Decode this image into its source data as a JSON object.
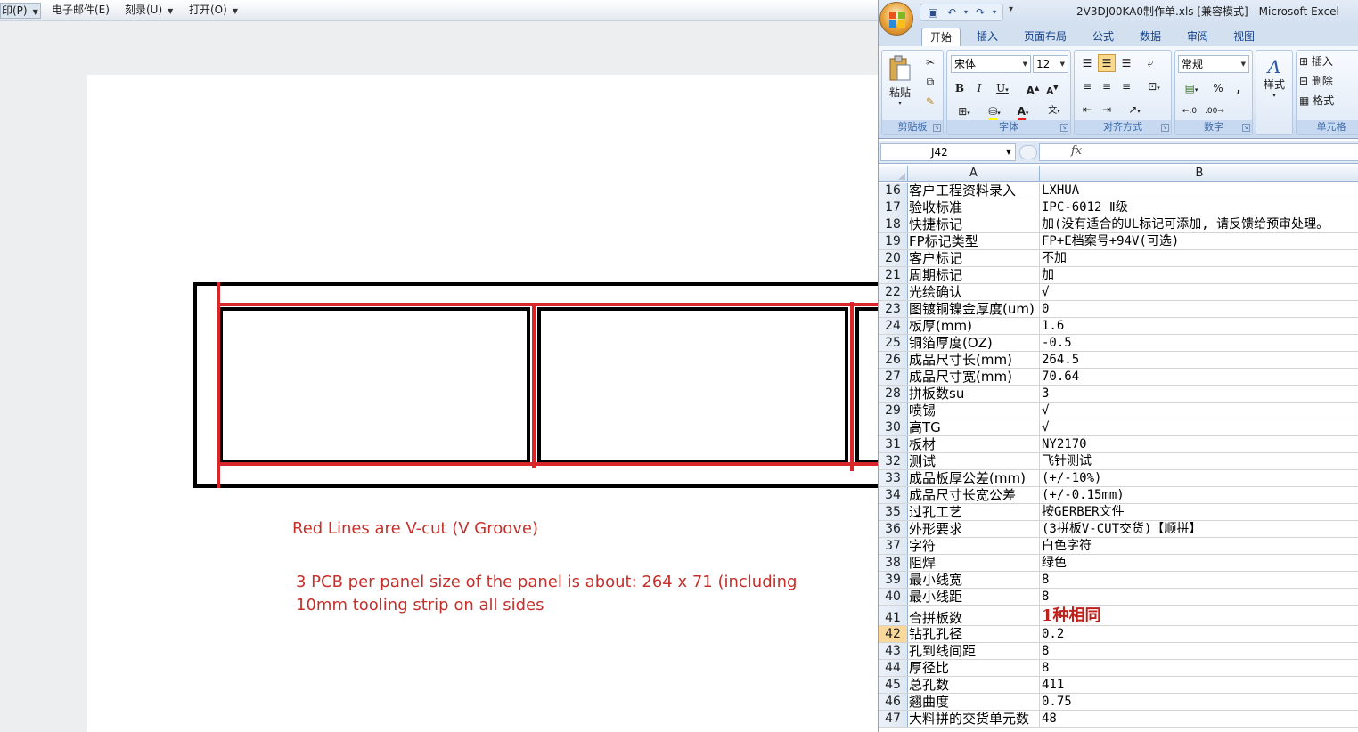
{
  "explorer_bar": {
    "print_label": "印(P)",
    "email_label": "电子邮件(E)",
    "burn_label": "刻录(U)",
    "open_label": "打开(O)"
  },
  "document": {
    "vcut_note": "Red Lines are V-cut (V Groove)",
    "panel_note_line1": "3 PCB per panel  size of the panel is about:  264 x 71  (including",
    "panel_note_line2": "10mm tooling strip on all sides",
    "colors": {
      "board_outline": "#000000",
      "vcut": "#d9262b",
      "text": "#c4302b"
    }
  },
  "excel": {
    "window_title": "2V3DJ00KA0制作单.xls  [兼容模式] - Microsoft Excel",
    "tabs": [
      "开始",
      "插入",
      "页面布局",
      "公式",
      "数据",
      "审阅",
      "视图"
    ],
    "active_tab": "开始",
    "ribbon": {
      "clipboard": {
        "paste_label": "粘贴",
        "group_label": "剪贴板"
      },
      "font": {
        "font_name": "宋体",
        "font_size": "12",
        "group_label": "字体"
      },
      "alignment": {
        "group_label": "对齐方式"
      },
      "number": {
        "format": "常规",
        "group_label": "数字"
      },
      "styles": {
        "label": "样式"
      },
      "cells": {
        "insert_label": "插入",
        "delete_label": "删除",
        "format_label": "格式",
        "group_label": "单元格"
      }
    },
    "name_box": "J42",
    "fx_label": "fx",
    "columns": [
      "A",
      "B"
    ],
    "selected_row": "42",
    "rows": [
      {
        "num": "16",
        "a": "客户工程资料录入",
        "b": "LXHUA"
      },
      {
        "num": "17",
        "a": "验收标准",
        "b": "IPC-6012 Ⅱ级"
      },
      {
        "num": "18",
        "a": "快捷标记",
        "b": "加(没有适合的UL标记可添加, 请反馈给预审处理。"
      },
      {
        "num": "19",
        "a": "FP标记类型",
        "b": "FP+E档案号+94V(可选)"
      },
      {
        "num": "20",
        "a": "客户标记",
        "b": "不加"
      },
      {
        "num": "21",
        "a": "周期标记",
        "b": "加"
      },
      {
        "num": "22",
        "a": "光绘确认",
        "b": "√"
      },
      {
        "num": "23",
        "a": "图镀铜镍金厚度(um)",
        "b": "0"
      },
      {
        "num": "24",
        "a": "板厚(mm)",
        "b": "1.6"
      },
      {
        "num": "25",
        "a": "铜箔厚度(OZ)",
        "b": "-0.5"
      },
      {
        "num": "26",
        "a": "成品尺寸长(mm)",
        "b": "264.5"
      },
      {
        "num": "27",
        "a": "成品尺寸宽(mm)",
        "b": "70.64"
      },
      {
        "num": "28",
        "a": "拼板数su",
        "b": "3"
      },
      {
        "num": "29",
        "a": "喷锡",
        "b": "√"
      },
      {
        "num": "30",
        "a": "高TG",
        "b": "√"
      },
      {
        "num": "31",
        "a": "板材",
        "b": "NY2170"
      },
      {
        "num": "32",
        "a": "测试",
        "b": "飞针测试"
      },
      {
        "num": "33",
        "a": "成品板厚公差(mm)",
        "b": "(+/-10%)"
      },
      {
        "num": "34",
        "a": "成品尺寸长宽公差",
        "b": "(+/-0.15mm)"
      },
      {
        "num": "35",
        "a": "过孔工艺",
        "b": "按GERBER文件"
      },
      {
        "num": "36",
        "a": "外形要求",
        "b": "(3拼板V-CUT交货)【顺拼】"
      },
      {
        "num": "37",
        "a": "字符",
        "b": "白色字符"
      },
      {
        "num": "38",
        "a": "阻焊",
        "b": "绿色"
      },
      {
        "num": "39",
        "a": "最小线宽",
        "b": "8"
      },
      {
        "num": "40",
        "a": "最小线距",
        "b": "8"
      },
      {
        "num": "41",
        "a": "合拼板数",
        "b": "1种相同",
        "emphasis": true
      },
      {
        "num": "42",
        "a": "钻孔孔径",
        "b": "0.2"
      },
      {
        "num": "43",
        "a": "孔到线间距",
        "b": "8"
      },
      {
        "num": "44",
        "a": "厚径比",
        "b": "8"
      },
      {
        "num": "45",
        "a": "总孔数",
        "b": "411"
      },
      {
        "num": "46",
        "a": "翘曲度",
        "b": "0.75"
      },
      {
        "num": "47",
        "a": "大料拼的交货单元数",
        "b": "48"
      }
    ]
  }
}
